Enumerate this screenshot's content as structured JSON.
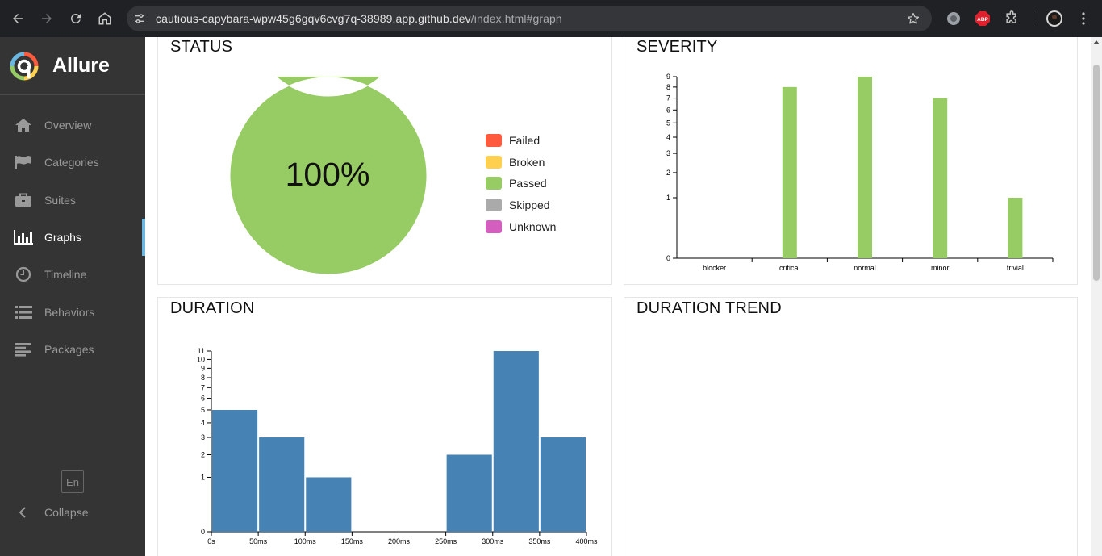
{
  "browser": {
    "url_host": "cautious-capybara-wpw45g6gqv6cvg7q-38989.app.github.dev",
    "url_path": "/index.html#graph",
    "ext_abp_label": "ABP"
  },
  "sidebar": {
    "brand": "Allure",
    "items": [
      {
        "label": "Overview",
        "icon": "home-icon",
        "active": false
      },
      {
        "label": "Categories",
        "icon": "flag-icon",
        "active": false
      },
      {
        "label": "Suites",
        "icon": "briefcase-icon",
        "active": false
      },
      {
        "label": "Graphs",
        "icon": "bar-chart-icon",
        "active": true
      },
      {
        "label": "Timeline",
        "icon": "clock-icon",
        "active": false
      },
      {
        "label": "Behaviors",
        "icon": "list-icon",
        "active": false
      },
      {
        "label": "Packages",
        "icon": "align-left-icon",
        "active": false
      }
    ],
    "language": "En",
    "collapse": "Collapse"
  },
  "widgets": {
    "status": {
      "title": "STATUS",
      "center_text": "100%"
    },
    "severity": {
      "title": "SEVERITY"
    },
    "duration": {
      "title": "DURATION"
    },
    "trend": {
      "title": "DURATION TREND"
    }
  },
  "colors": {
    "failed": "#fd5a3e",
    "broken": "#ffd050",
    "passed": "#97cc64",
    "skipped": "#aaaaaa",
    "unknown": "#d35ebe",
    "duration_bar": "#4682b4",
    "sidebar_bg": "#343434",
    "active_accent": "#6ab7e1"
  },
  "chart_data": [
    {
      "chart": "status",
      "type": "pie",
      "categories": [
        "Failed",
        "Broken",
        "Passed",
        "Skipped",
        "Unknown"
      ],
      "values": [
        0,
        0,
        32,
        0,
        0
      ],
      "center_label": "100%",
      "legend": "right"
    },
    {
      "chart": "severity",
      "type": "bar",
      "categories": [
        "blocker",
        "critical",
        "normal",
        "minor",
        "trivial"
      ],
      "values": [
        0,
        8,
        9,
        7,
        1
      ],
      "yticks": [
        0,
        1,
        2,
        3,
        4,
        5,
        6,
        7,
        8,
        9
      ],
      "yscale": "sqrt",
      "ylim": [
        0,
        9
      ]
    },
    {
      "chart": "duration",
      "type": "bar",
      "bins": [
        [
          0,
          50
        ],
        [
          50,
          100
        ],
        [
          100,
          150
        ],
        [
          150,
          200
        ],
        [
          200,
          250
        ],
        [
          250,
          300
        ],
        [
          300,
          350
        ],
        [
          350,
          400
        ]
      ],
      "values": [
        5,
        3,
        1,
        0,
        0,
        2,
        11,
        3
      ],
      "xticks": [
        "0s",
        "50ms",
        "100ms",
        "150ms",
        "200ms",
        "250ms",
        "300ms",
        "350ms",
        "400ms"
      ],
      "yticks": [
        0,
        1,
        2,
        3,
        4,
        5,
        6,
        7,
        8,
        9,
        10,
        11
      ],
      "yscale": "sqrt",
      "ylim": [
        0,
        11
      ]
    }
  ]
}
